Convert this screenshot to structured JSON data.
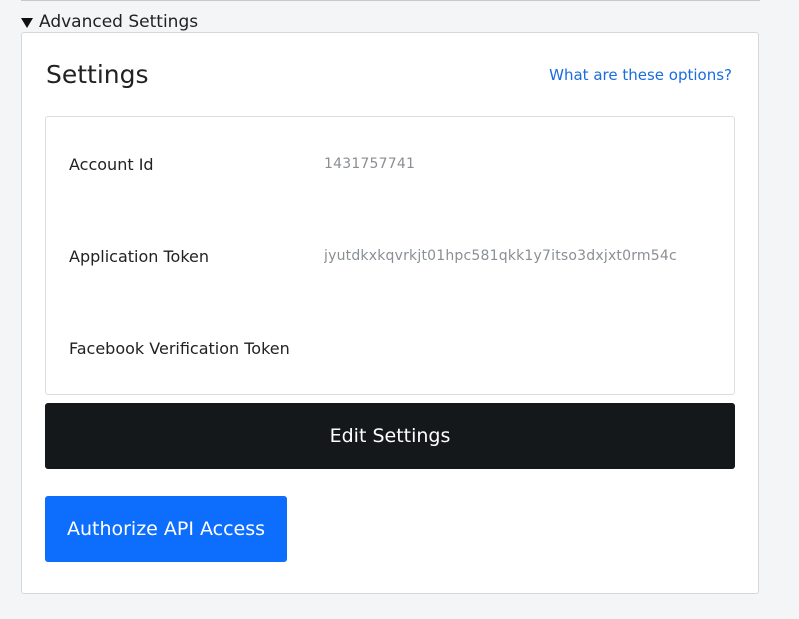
{
  "disclosure": {
    "label": "Advanced Settings",
    "expanded": true
  },
  "panel": {
    "title": "Settings",
    "help_link": "What are these options?"
  },
  "settings": [
    {
      "label": "Account Id",
      "value": "1431757741"
    },
    {
      "label": "Application Token",
      "value": "jyutdkxkqvrkjt01hpc581qkk1y7itso3dxjxt0rm54c"
    },
    {
      "label": "Facebook Verification Token",
      "value": ""
    }
  ],
  "buttons": {
    "edit": "Edit Settings",
    "authorize": "Authorize API Access"
  },
  "colors": {
    "link": "#1a6ce0",
    "edit_button": "#15181b",
    "authorize_button": "#0d6efd"
  }
}
